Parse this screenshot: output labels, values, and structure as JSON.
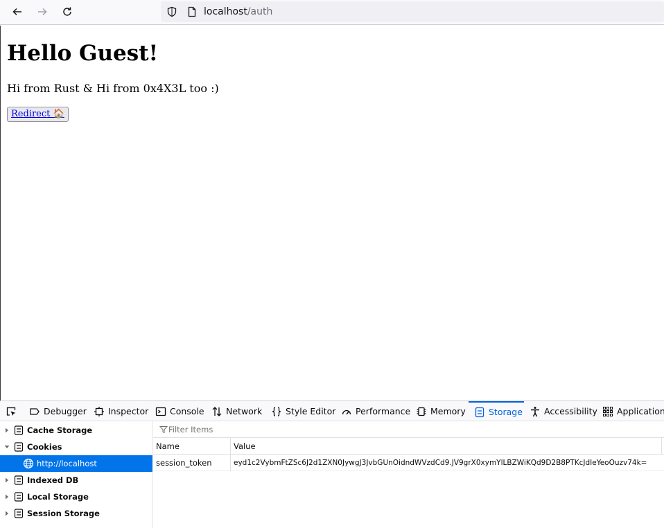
{
  "browser": {
    "url_host": "localhost",
    "url_path": "/auth"
  },
  "page": {
    "heading": "Hello Guest!",
    "message": "Hi from Rust & Hi from 0x4X3L too :)",
    "redirect_label": "Redirect 🏠"
  },
  "devtools": {
    "tabs": [
      {
        "label": "Debugger",
        "icon": "debugger-icon"
      },
      {
        "label": "Inspector",
        "icon": "inspector-icon"
      },
      {
        "label": "Console",
        "icon": "console-icon"
      },
      {
        "label": "Network",
        "icon": "network-icon"
      },
      {
        "label": "Style Editor",
        "icon": "style-editor-icon"
      },
      {
        "label": "Performance",
        "icon": "performance-icon"
      },
      {
        "label": "Memory",
        "icon": "memory-icon"
      },
      {
        "label": "Storage",
        "icon": "storage-icon",
        "selected": true
      },
      {
        "label": "Accessibility",
        "icon": "accessibility-icon"
      },
      {
        "label": "Application",
        "icon": "application-icon"
      }
    ],
    "sidebar": {
      "items": [
        {
          "label": "Cache Storage",
          "expanded": false
        },
        {
          "label": "Cookies",
          "expanded": true
        },
        {
          "label": "http://localhost",
          "selected": true
        },
        {
          "label": "Indexed DB",
          "expanded": false
        },
        {
          "label": "Local Storage",
          "expanded": false
        },
        {
          "label": "Session Storage",
          "expanded": false
        }
      ]
    },
    "filter_placeholder": "Filter Items",
    "table": {
      "columns": [
        "Name",
        "Value"
      ],
      "rows": [
        {
          "name": "session_token",
          "value": "eyd1c2VybmFtZSc6J2d1ZXN0JywgJ3JvbGUnOidndWVzdCd9.JV9grX0xymYlLBZWiKQd9D2B8PTKcJdIeYeoOuzv74k="
        }
      ]
    },
    "colors": {
      "accent": "#0060df",
      "selection": "#0074e8"
    }
  }
}
